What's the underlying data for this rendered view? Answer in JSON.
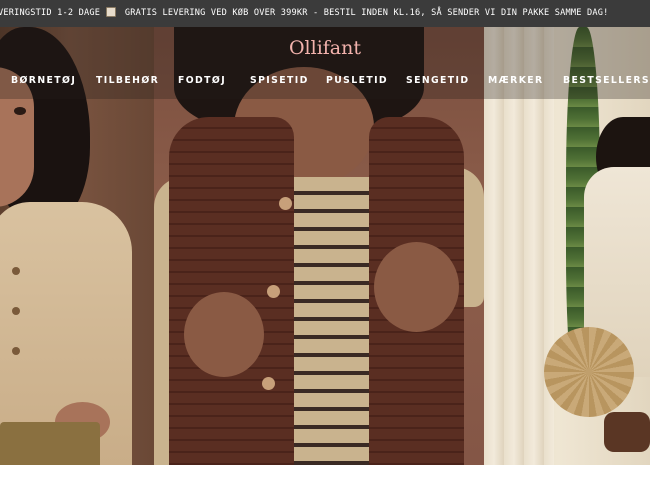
{
  "announcement": {
    "text_1": "VERINGSTID 1-2 DAGE",
    "icon": "box-icon",
    "text_2": "GRATIS LEVERING VED KØB OVER 399KR - BESTIL INDEN KL.16, SÅ SENDER VI DIN PAKKE SAMME DAG!"
  },
  "header": {
    "logo": "Ollifant",
    "logo_color": "#f3b3ad",
    "menu": [
      {
        "label": "BØRNETØJ"
      },
      {
        "label": "TILBEHØR"
      },
      {
        "label": "FODTØJ"
      },
      {
        "label": "SPISETID"
      },
      {
        "label": "PUSLETID"
      },
      {
        "label": "SENGETID"
      },
      {
        "label": "MÆRKER"
      },
      {
        "label": "BESTSELLERS"
      }
    ]
  },
  "hero": {
    "panels": [
      {
        "name": "child-cream-cardigan-photo"
      },
      {
        "name": "child-brown-quilted-vest-photo"
      },
      {
        "name": "child-cream-dress-photo"
      }
    ]
  },
  "colors": {
    "ticker_bg": "#3b3b3b",
    "nav_text": "#ffffff"
  }
}
